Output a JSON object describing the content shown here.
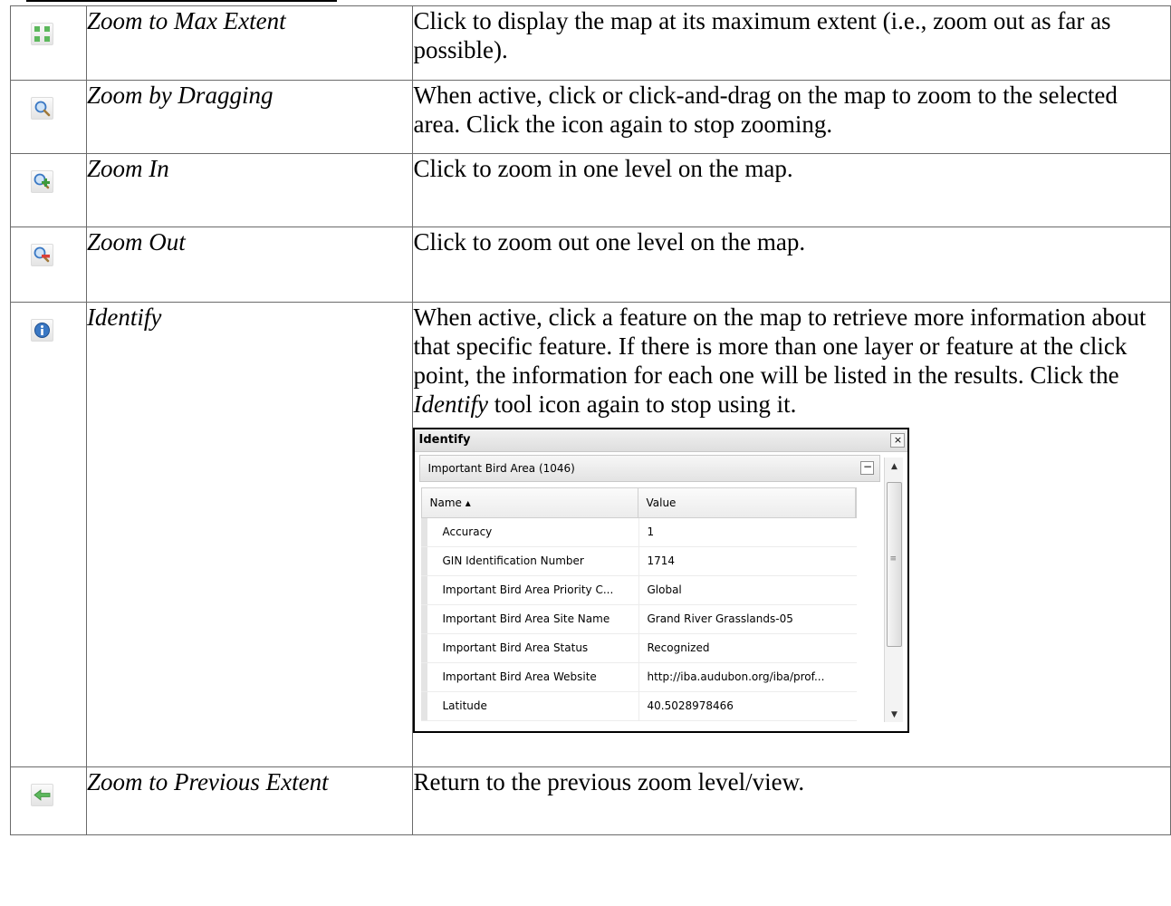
{
  "rows": [
    {
      "icon": "zoom-max-extent-icon",
      "name": "Zoom to Max Extent",
      "desc": "Click to display the map at its maximum extent (i.e., zoom out as far as possible)."
    },
    {
      "icon": "zoom-drag-icon",
      "name": "Zoom by Dragging",
      "desc": "When active, click or click-and-drag on the map to zoom to the selected area. Click the icon again to stop zooming."
    },
    {
      "icon": "zoom-in-icon",
      "name": "Zoom In",
      "desc": "Click to zoom in one level on the map."
    },
    {
      "icon": "zoom-out-icon",
      "name": "Zoom Out",
      "desc": "Click to zoom out one level on the map."
    },
    {
      "icon": "identify-icon",
      "name": "Identify",
      "desc_a": "When active, click a feature on the map to retrieve more information about that specific feature. If there is more than one layer or feature at the click point, the information for each one will be listed in the results. Click the ",
      "desc_em": "Identify",
      "desc_b": " tool icon again to stop using it."
    },
    {
      "icon": "previous-extent-icon",
      "name": "Zoom to Previous Extent",
      "desc": "Return to the previous zoom level/view."
    }
  ],
  "identify_panel": {
    "title": "Identify",
    "close": "×",
    "group": "Important Bird Area (1046)",
    "collapse": "−",
    "col_name": "Name ▴",
    "col_value": "Value",
    "fields": [
      {
        "name": "Accuracy",
        "value": "1"
      },
      {
        "name": "GIN Identification Number",
        "value": "1714"
      },
      {
        "name": "Important Bird Area Priority C...",
        "value": "Global"
      },
      {
        "name": "Important Bird Area Site Name",
        "value": "Grand River Grasslands-05"
      },
      {
        "name": "Important Bird Area Status",
        "value": "Recognized"
      },
      {
        "name": "Important Bird Area Website",
        "value": "http://iba.audubon.org/iba/prof..."
      },
      {
        "name": "Latitude",
        "value": "40.5028978466"
      }
    ]
  },
  "colors": {
    "icon_green": "#5cb85c",
    "icon_blue": "#3a78c4",
    "icon_red": "#d9413a",
    "border": "#6b6b6b"
  }
}
